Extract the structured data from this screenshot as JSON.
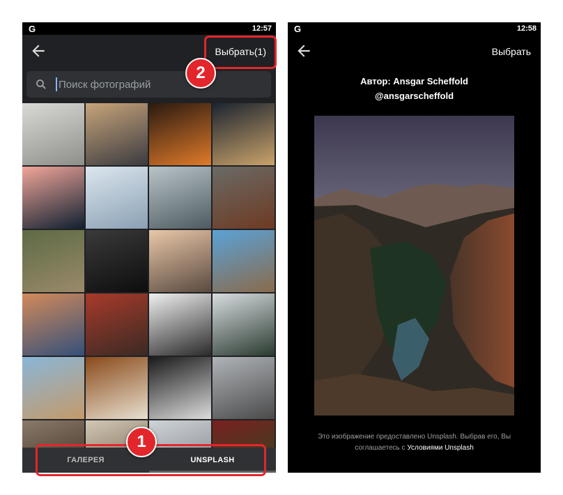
{
  "left_screen": {
    "status_bar": {
      "logo": "G",
      "time": "12:57"
    },
    "app_bar": {
      "back_icon": "arrow-left-icon",
      "select_label": "Выбрать(1)"
    },
    "search": {
      "placeholder": "Поиск фотографий",
      "icon": "search-icon"
    },
    "photo_grid": {
      "tiles": [
        {
          "name": "laptop-desk-photo",
          "colors": [
            "#d9d9d6",
            "#8f8f8a"
          ]
        },
        {
          "name": "city-street-photo",
          "colors": [
            "#c7a47a",
            "#3b3b40"
          ]
        },
        {
          "name": "neon-clock-photo",
          "colors": [
            "#2a1a10",
            "#e07a2a"
          ]
        },
        {
          "name": "city-lights-photo",
          "colors": [
            "#1c2430",
            "#caa36a"
          ]
        },
        {
          "name": "hole-illustration-photo",
          "colors": [
            "#f2a69a",
            "#0f2030"
          ]
        },
        {
          "name": "girl-running-photo",
          "colors": [
            "#dce6ee",
            "#8aa0b4"
          ]
        },
        {
          "name": "waterfall-photo",
          "colors": [
            "#b9c4c8",
            "#4d5b60"
          ]
        },
        {
          "name": "canyon-thumbnail-photo",
          "colors": [
            "#6a6a66",
            "#6e3a22"
          ]
        },
        {
          "name": "man-with-dog-photo",
          "colors": [
            "#5d6a44",
            "#9a8a6a"
          ]
        },
        {
          "name": "dark-room-photo",
          "colors": [
            "#3a3a3a",
            "#0d0d0d"
          ]
        },
        {
          "name": "beach-sunset-photo",
          "colors": [
            "#e9c7a8",
            "#5a4a40"
          ]
        },
        {
          "name": "graffiti-wall-photo",
          "colors": [
            "#5aa2d8",
            "#8a6a4a"
          ]
        },
        {
          "name": "blue-mountains-photo",
          "colors": [
            "#d38a5a",
            "#34507a"
          ]
        },
        {
          "name": "cafe-people-photo",
          "colors": [
            "#a83a2a",
            "#3a2a24"
          ]
        },
        {
          "name": "woman-donut-photo",
          "colors": [
            "#f0f0f0",
            "#2a2a2a"
          ]
        },
        {
          "name": "snowy-forest-photo",
          "colors": [
            "#d8dde0",
            "#2a3a30"
          ]
        },
        {
          "name": "tablet-map-photo",
          "colors": [
            "#8ab6d8",
            "#c49a6a"
          ]
        },
        {
          "name": "pomeranian-photo",
          "colors": [
            "#8a4a1a",
            "#e8e0d0"
          ]
        },
        {
          "name": "husky-photo",
          "colors": [
            "#1a1a1a",
            "#dcdcdc"
          ]
        },
        {
          "name": "rainy-street-photo",
          "colors": [
            "#b0b4b8",
            "#4a4a4a"
          ]
        },
        {
          "name": "coffee-photo",
          "colors": [
            "#8a7a6a",
            "#3a2a20"
          ]
        },
        {
          "name": "jacket-photo",
          "colors": [
            "#d2c8b4",
            "#6a5a4a"
          ]
        },
        {
          "name": "building-photo",
          "colors": [
            "#cfd4d8",
            "#7a7e82"
          ]
        },
        {
          "name": "flowers-photo",
          "colors": [
            "#7a2020",
            "#2a4a20"
          ]
        }
      ]
    },
    "tabs": [
      {
        "id": "gallery",
        "label": "ГАЛЕРЕЯ"
      },
      {
        "id": "unsplash",
        "label": "UNSPLASH"
      }
    ],
    "annotations": {
      "badge_1": "1",
      "badge_2": "2"
    }
  },
  "right_screen": {
    "status_bar": {
      "logo": "G",
      "time": "12:58"
    },
    "app_bar": {
      "back_icon": "arrow-left-icon",
      "select_label": "Выбрать"
    },
    "author": {
      "line1": "Автор: Ansgar Scheffold",
      "line2": "@ansgarscheffold"
    },
    "photo": {
      "description_icon": "canyon-photo"
    },
    "credit": {
      "line1": "Это изображение предоставлено Unsplash. Выбрав его, Вы",
      "line2_prefix": "соглашаетесь с ",
      "terms_link": "Условиями Unsplash"
    }
  },
  "colors": {
    "highlight": "#e3262b",
    "left_bg": "#202124",
    "right_bg": "#000000"
  }
}
